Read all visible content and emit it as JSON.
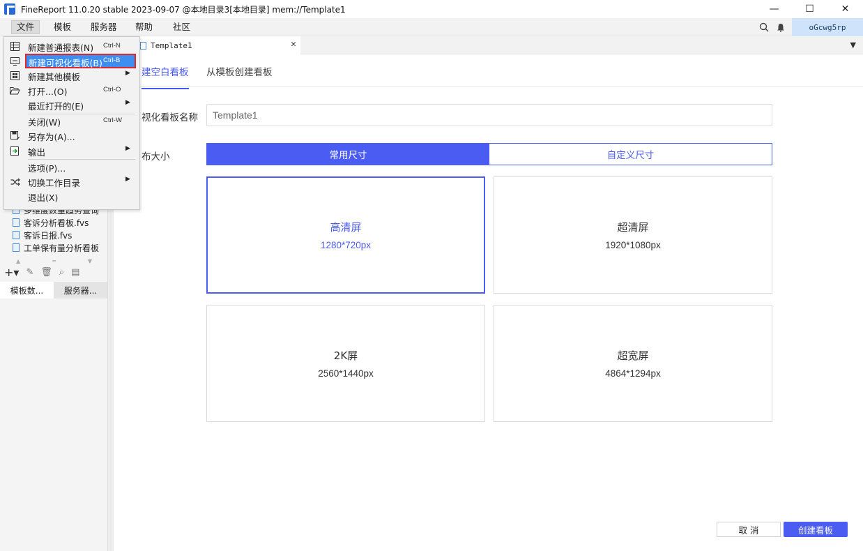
{
  "window": {
    "title": "FineReport 11.0.20 stable 2023-09-07 @本地目录3[本地目录]    mem://Template1",
    "minimize": "—",
    "maximize": "☐",
    "close": "✕"
  },
  "menubar": {
    "items": [
      "文件",
      "模板",
      "服务器",
      "帮助",
      "社区"
    ],
    "user": "oGcwg5rp"
  },
  "file_menu": {
    "items": [
      {
        "label": "新建普通报表(N)",
        "shortcut": "Ctrl-N",
        "icon": "grid-report-icon"
      },
      {
        "label": "新建可视化看板(B)",
        "shortcut": "Ctrl-B",
        "icon": "dashboard-icon"
      },
      {
        "label": "新建其他模板",
        "shortcut": "",
        "icon": "template-grid-icon"
      },
      {
        "label": "打开...(O)",
        "shortcut": "Ctrl-O",
        "icon": "folder-open-icon"
      },
      {
        "label": "最近打开的(E)",
        "shortcut": "",
        "icon": ""
      },
      {
        "label": "关闭(W)",
        "shortcut": "Ctrl-W",
        "icon": ""
      },
      {
        "label": "另存为(A)...",
        "shortcut": "",
        "icon": "save-as-icon"
      },
      {
        "label": "输出",
        "shortcut": "",
        "icon": "export-icon"
      },
      {
        "label": "选项(P)...",
        "shortcut": "",
        "icon": ""
      },
      {
        "label": "切换工作目录",
        "shortcut": "",
        "icon": "switch-icon"
      },
      {
        "label": "退出(X)",
        "shortcut": "",
        "icon": ""
      }
    ]
  },
  "left_panel": {
    "files": [
      "多维度数量趋势查询",
      "客诉分析看板.fvs",
      "客诉日报.fvs",
      "工单保有量分析看板"
    ],
    "tabs": [
      "模板数...",
      "服务器..."
    ]
  },
  "doc_tab": {
    "label": "Template1"
  },
  "main": {
    "subtabs": [
      "建空白看板",
      "从模板创建看板"
    ],
    "name_label": "视化看板名称",
    "name_value": "Template1",
    "size_label": "布大小",
    "size_modes": [
      "常用尺寸",
      "自定义尺寸"
    ],
    "cards": [
      {
        "title": "高清屏",
        "size": "1280*720px"
      },
      {
        "title": "超清屏",
        "size": "1920*1080px"
      },
      {
        "title": "2K屏",
        "size": "2560*1440px"
      },
      {
        "title": "超宽屏",
        "size": "4864*1294px"
      }
    ],
    "cancel": "取 消",
    "create": "创建看板"
  }
}
